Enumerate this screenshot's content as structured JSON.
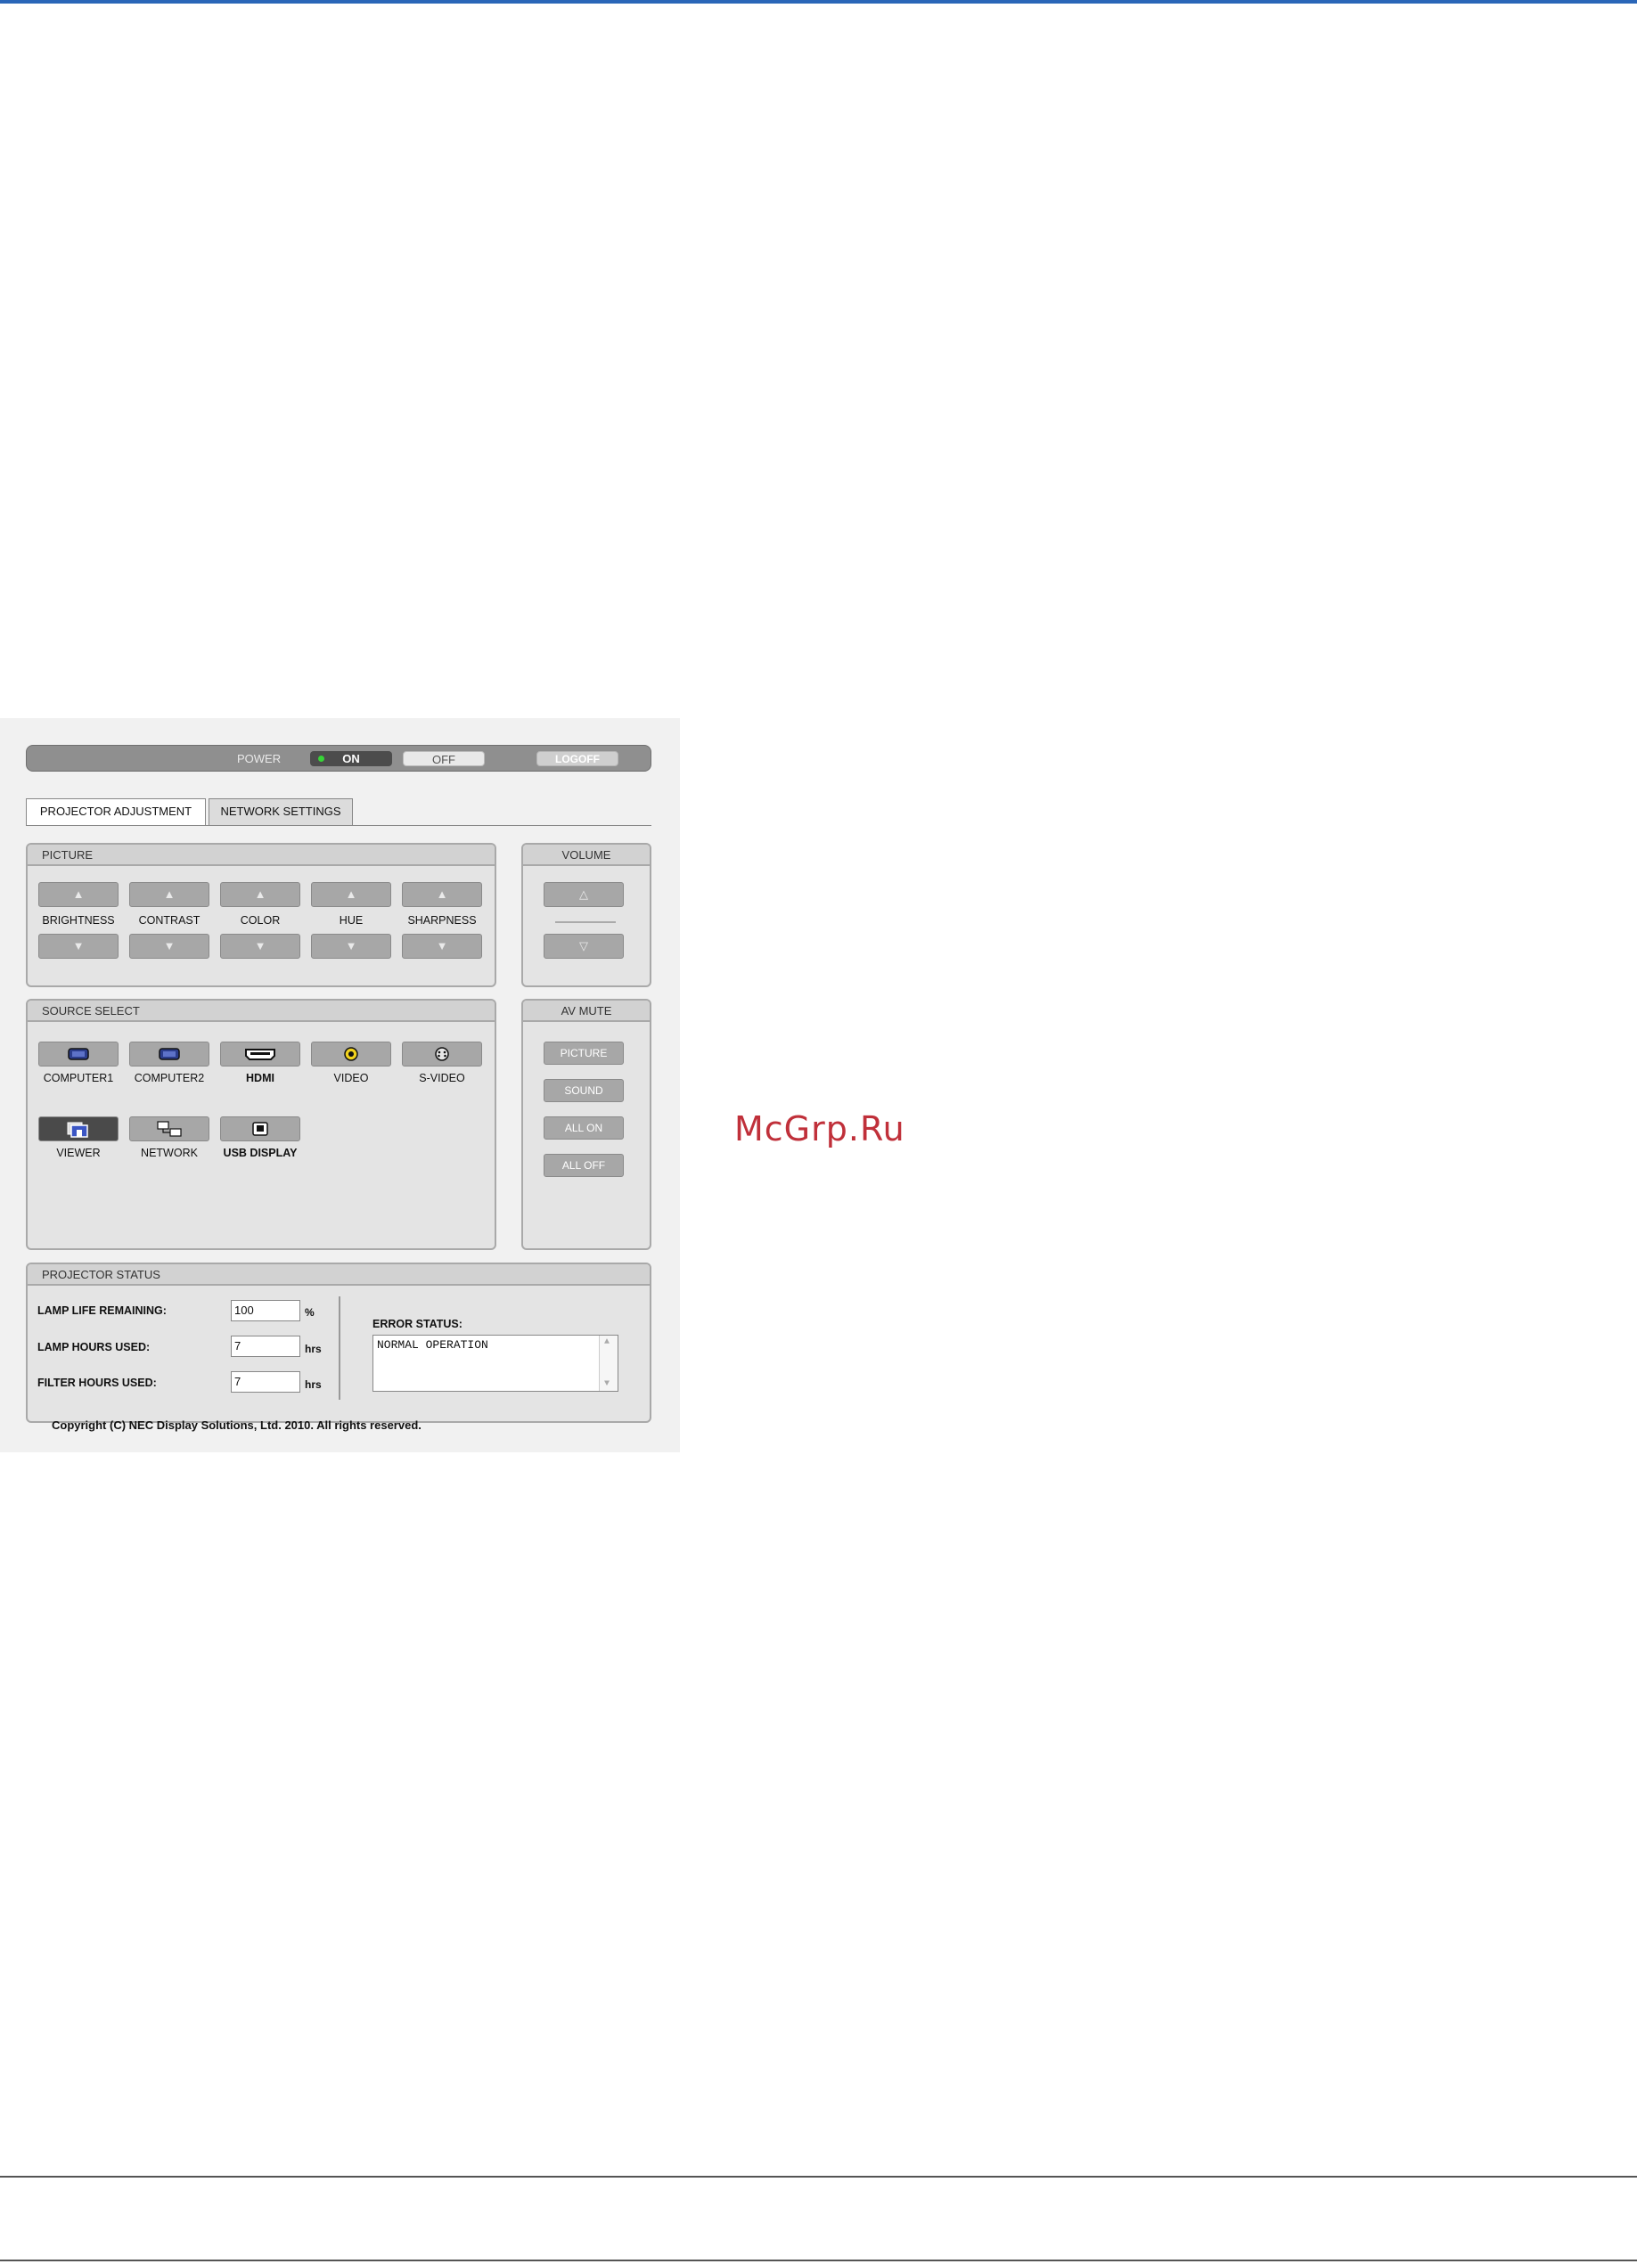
{
  "watermark": "McGrp.Ru",
  "power": {
    "label": "POWER",
    "on_label": "ON",
    "off_label": "OFF",
    "logoff_label": "LOGOFF"
  },
  "tabs": [
    {
      "label": "PROJECTOR ADJUSTMENT",
      "active": true
    },
    {
      "label": "NETWORK SETTINGS",
      "active": false
    }
  ],
  "picture": {
    "title": "PICTURE",
    "items": [
      "BRIGHTNESS",
      "CONTRAST",
      "COLOR",
      "HUE",
      "SHARPNESS"
    ]
  },
  "volume": {
    "title": "VOLUME"
  },
  "source_select": {
    "title": "SOURCE SELECT",
    "items": [
      {
        "label": "COMPUTER1",
        "icon": "vga-icon"
      },
      {
        "label": "COMPUTER2",
        "icon": "vga-icon"
      },
      {
        "label": "HDMI",
        "icon": "hdmi-icon"
      },
      {
        "label": "VIDEO",
        "icon": "rca-icon"
      },
      {
        "label": "S-VIDEO",
        "icon": "svideo-icon"
      },
      {
        "label": "VIEWER",
        "icon": "viewer-icon",
        "selected": true
      },
      {
        "label": "NETWORK",
        "icon": "network-icon"
      },
      {
        "label": "USB DISPLAY",
        "icon": "usb-icon"
      }
    ]
  },
  "av_mute": {
    "title": "AV MUTE",
    "buttons": [
      "PICTURE",
      "SOUND",
      "ALL ON",
      "ALL OFF"
    ]
  },
  "status": {
    "title": "PROJECTOR STATUS",
    "lamp_life_label": "LAMP LIFE REMAINING:",
    "lamp_life_value": "100",
    "lamp_life_unit": "%",
    "lamp_hours_label": "LAMP HOURS USED:",
    "lamp_hours_value": "7",
    "lamp_hours_unit": "hrs",
    "filter_hours_label": "FILTER HOURS USED:",
    "filter_hours_value": "7",
    "filter_hours_unit": "hrs",
    "error_label": "ERROR STATUS:",
    "error_value": "NORMAL OPERATION"
  },
  "copyright": "Copyright (C) NEC Display Solutions, Ltd. 2010. All rights reserved.",
  "colors": {
    "accent_line": "#2a66b8",
    "watermark": "#c0303a",
    "power_led": "#37d437"
  }
}
